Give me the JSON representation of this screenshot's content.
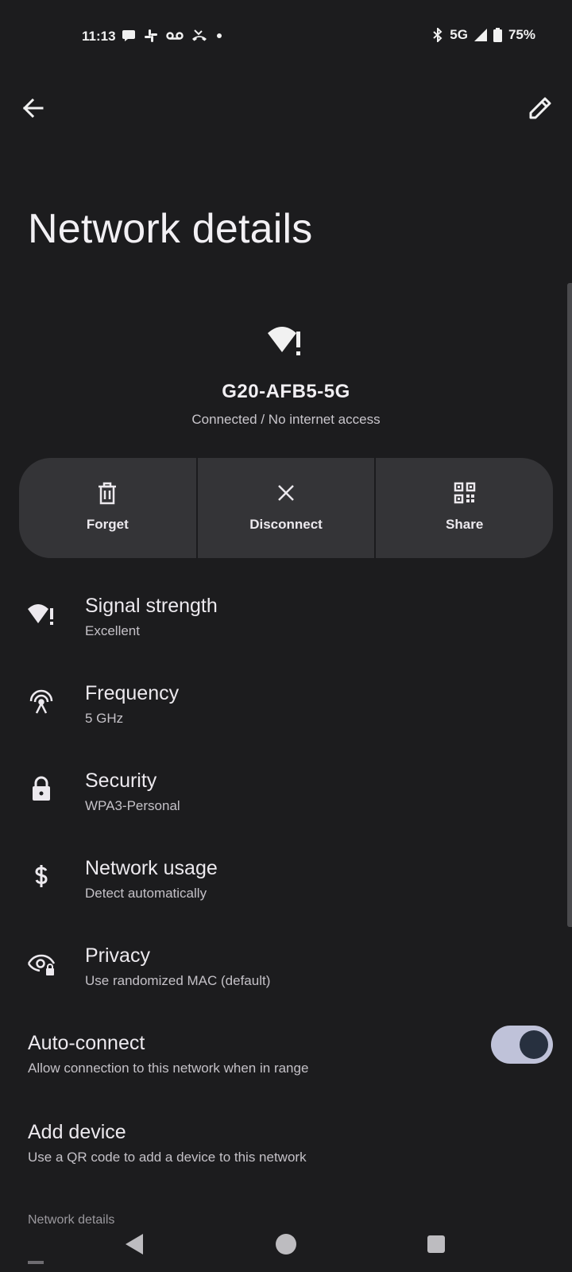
{
  "status_bar": {
    "time": "11:13",
    "network_type": "5G",
    "battery": "75%",
    "left_icons": [
      "chat-bubble-icon",
      "slack-icon",
      "voicemail-icon",
      "missed-call-icon",
      "dot-icon"
    ],
    "right_icons": [
      "bluetooth-icon",
      "cell-signal-icon",
      "battery-icon"
    ]
  },
  "top_bar": {
    "back_icon": "arrow-back-icon",
    "edit_icon": "pencil-icon"
  },
  "page": {
    "title": "Network details"
  },
  "network": {
    "ssid": "G20-AFB5-5G",
    "status": "Connected / No internet access",
    "icon": "wifi-no-internet-icon"
  },
  "actions": [
    {
      "label": "Forget",
      "icon": "trash-icon"
    },
    {
      "label": "Disconnect",
      "icon": "close-icon"
    },
    {
      "label": "Share",
      "icon": "qr-code-icon"
    }
  ],
  "details": [
    {
      "title": "Signal strength",
      "subtitle": "Excellent",
      "icon": "wifi-no-internet-icon"
    },
    {
      "title": "Frequency",
      "subtitle": "5 GHz",
      "icon": "antenna-icon"
    },
    {
      "title": "Security",
      "subtitle": "WPA3-Personal",
      "icon": "lock-icon"
    },
    {
      "title": "Network usage",
      "subtitle": "Detect automatically",
      "icon": "dollar-icon"
    },
    {
      "title": "Privacy",
      "subtitle": "Use randomized MAC (default)",
      "icon": "eye-lock-icon"
    }
  ],
  "auto_connect": {
    "title": "Auto-connect",
    "subtitle": "Allow connection to this network when in range",
    "enabled": true
  },
  "add_device": {
    "title": "Add device",
    "subtitle": "Use a QR code to add a device to this network"
  },
  "section_header": "Network details",
  "colors": {
    "background": "#1c1c1e",
    "surface": "#343437",
    "switch_track": "#bfc2d9",
    "switch_knob": "#27303f"
  }
}
